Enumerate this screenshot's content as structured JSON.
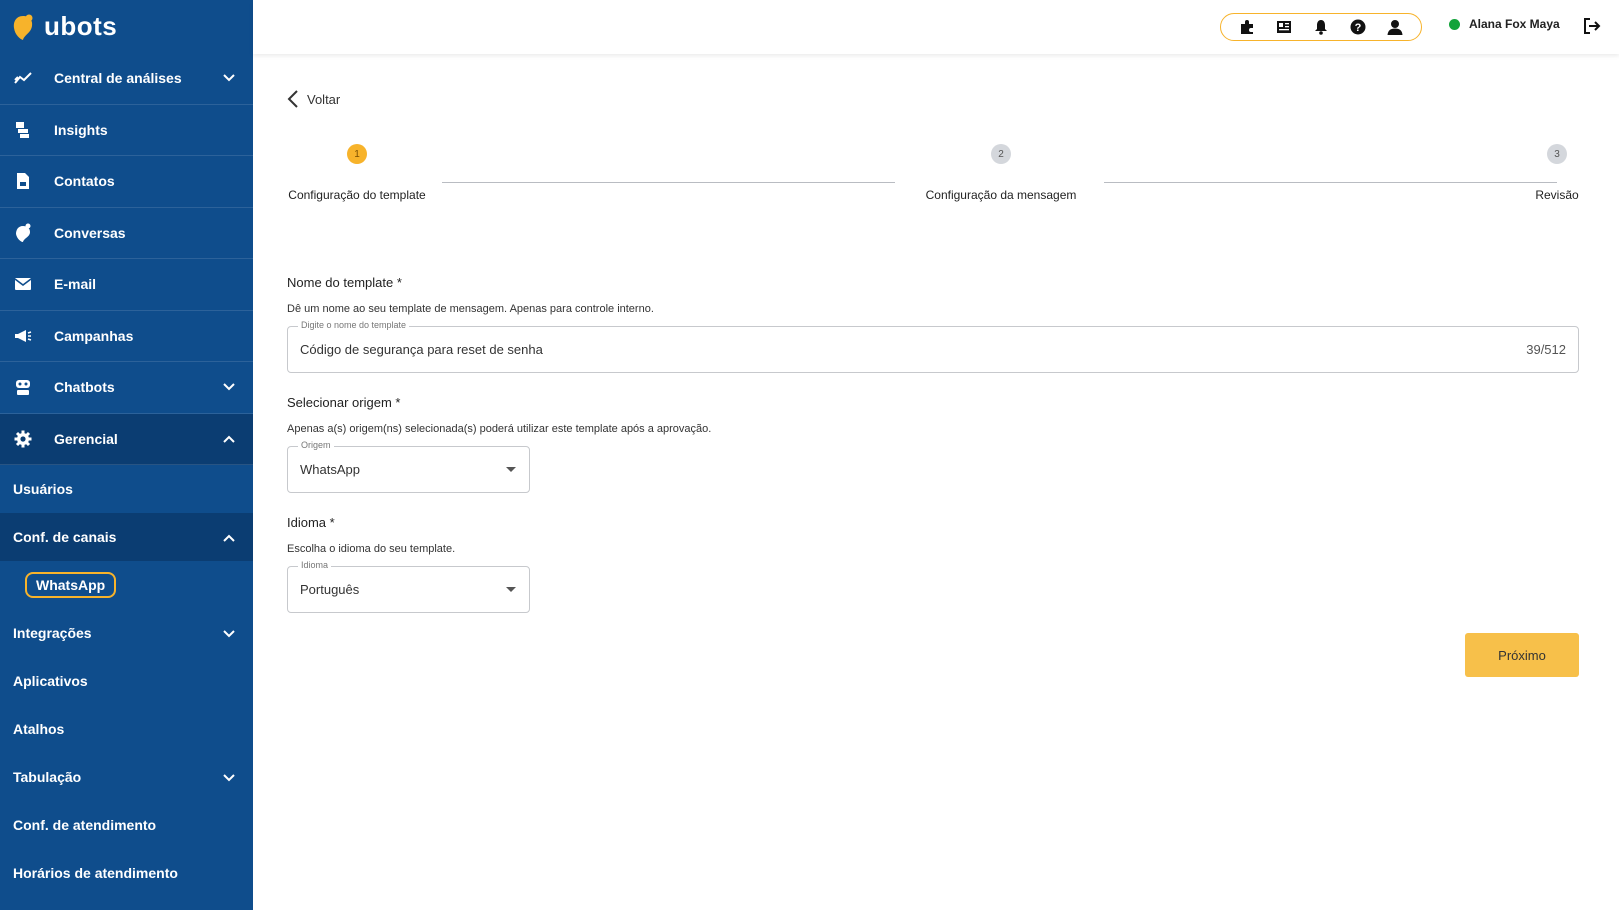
{
  "app": {
    "brand": "ubots",
    "brand_color": "#f7b32b",
    "sidebar_color": "#0f4d8c"
  },
  "sidebar": {
    "items": [
      {
        "label": "Central de análises",
        "icon": "analytics-icon",
        "expandable": true
      },
      {
        "label": "Insights",
        "icon": "insights-icon",
        "expandable": false
      },
      {
        "label": "Contatos",
        "icon": "contacts-icon",
        "expandable": false
      },
      {
        "label": "Conversas",
        "icon": "conversations-icon",
        "expandable": false
      },
      {
        "label": "E-mail",
        "icon": "email-icon",
        "expandable": false
      },
      {
        "label": "Campanhas",
        "icon": "megaphone-icon",
        "expandable": false
      },
      {
        "label": "Chatbots",
        "icon": "robot-icon",
        "expandable": true
      },
      {
        "label": "Gerencial",
        "icon": "gear-icon",
        "expandable": true,
        "expanded": true
      }
    ],
    "gerencial_sub": [
      {
        "label": "Usuários"
      },
      {
        "label": "Conf. de canais",
        "expanded": true
      },
      {
        "label": "Integrações",
        "expandable": true
      },
      {
        "label": "Aplicativos"
      },
      {
        "label": "Atalhos"
      },
      {
        "label": "Tabulação",
        "expandable": true
      },
      {
        "label": "Conf. de atendimento"
      },
      {
        "label": "Horários de atendimento"
      }
    ],
    "channels_sub": [
      {
        "label": "WhatsApp",
        "selected": true
      }
    ]
  },
  "topbar": {
    "icons": [
      "puzzle-icon",
      "news-icon",
      "bell-icon",
      "help-icon",
      "user-icon"
    ],
    "user_name": "Alana Fox Maya",
    "status_color": "#12a33a"
  },
  "main": {
    "back_label": "Voltar",
    "steps": [
      {
        "number": "1",
        "label": "Configuração do template",
        "active": true
      },
      {
        "number": "2",
        "label": "Configuração da mensagem",
        "active": false
      },
      {
        "number": "3",
        "label": "Revisão",
        "active": false
      }
    ],
    "template_name": {
      "title": "Nome do template *",
      "help": "Dê um nome ao seu template de mensagem. Apenas para controle interno.",
      "legend": "Digite o nome do template",
      "value": "Código de segurança para reset de senha",
      "counter": "39/512"
    },
    "origin": {
      "title": "Selecionar origem *",
      "help": "Apenas a(s) origem(ns) selecionada(s) poderá utilizar este template após a aprovação.",
      "legend": "Origem",
      "value": "WhatsApp"
    },
    "language": {
      "title": "Idioma *",
      "help": "Escolha o idioma do seu template.",
      "legend": "Idioma",
      "value": "Português"
    },
    "next_label": "Próximo"
  }
}
